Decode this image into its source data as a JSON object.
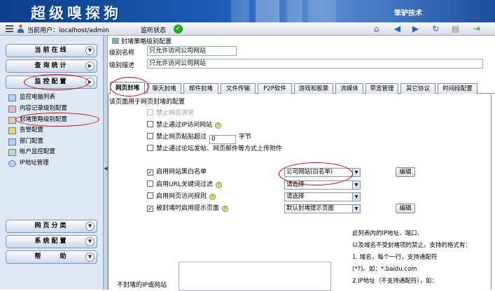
{
  "app": {
    "title": "超级嗅探狗",
    "vendor": "笨驴技术"
  },
  "toolbar": {
    "current_user": "当前用户：localhost/admin",
    "monitor_status": "监听状态"
  },
  "sidebar": {
    "sections": [
      "当前在线",
      "查询统计",
      "监控配置"
    ],
    "items": [
      "监控电脑列表",
      "内容记录级别配置",
      "封堵策略级别配置",
      "告警配置",
      "部门配置",
      "帐户监控配置",
      "IP地址管理"
    ],
    "bottom_sections": [
      "网页分类",
      "系统配置",
      "帮　　助"
    ]
  },
  "main": {
    "breadcrumb": "封堵策略级别配置",
    "level_name_label": "级别名称",
    "level_name_value": "只允许访问公司网站",
    "level_desc_label": "级别描述",
    "level_desc_value": "只允许访问公司网站",
    "tabs": [
      "网页封堵",
      "聊天封堵",
      "邮件封堵",
      "文件传输",
      "P2P软件",
      "游戏和股票",
      "流媒体",
      "带宽管理",
      "其它协议",
      "时间段配置"
    ],
    "panel_desc": "该页面用于网页封堵的配置",
    "options": {
      "ban_browse": "禁止网页浏览",
      "ban_ip": "禁止通过IP访问网站",
      "ban_post_prefix": "禁止网页粘贴超过",
      "ban_post_value": "0",
      "ban_post_suffix": "字节",
      "ban_upload": "禁止通过论坛发帖、网页邮件等方式上传附件",
      "whitelist": "启用网站黑白名单",
      "url_filter": "启用URL关键词过滤",
      "access_rules": "启用网页访问规则",
      "block_page": "被封堵时启用提示页面"
    },
    "selects": {
      "whitelist": "公司网站(白名单)",
      "url_filter": "请选择",
      "access_rules": "请选择",
      "block_page": "默认封堵提示页面"
    },
    "edit_label": "编辑",
    "unblocked_label": "不封堵的IP或网站",
    "notes": [
      "此列表内的IP地址、端口、",
      "以及域名不受封堵项的禁止。支持的格式有：",
      "1. 域名，每个一行，支持通配符",
      "(*?)。如：*.baidu.com",
      "2.IP地址（不支持通配符），如："
    ]
  },
  "colors": {
    "banner": "#1e5db6",
    "annotation_oval": "#cc0000",
    "status_ok": "#26a526"
  }
}
